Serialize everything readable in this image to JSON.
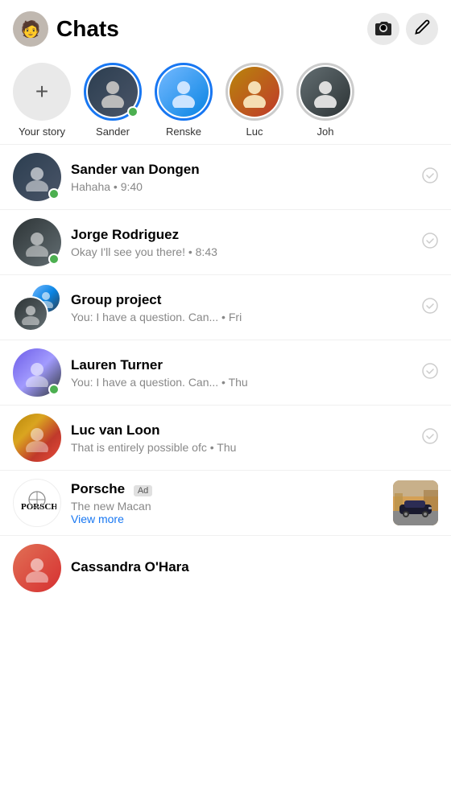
{
  "header": {
    "title": "Chats",
    "camera_icon": "📷",
    "edit_icon": "✏"
  },
  "stories": {
    "add_label": "Your story",
    "items": [
      {
        "id": "sander",
        "label": "Sander",
        "online": true,
        "has_ring": true,
        "color_class": "story-sander"
      },
      {
        "id": "renske",
        "label": "Renske",
        "online": false,
        "has_ring": true,
        "color_class": "story-renske"
      },
      {
        "id": "luc",
        "label": "Luc",
        "online": false,
        "has_ring": false,
        "color_class": "story-luc"
      },
      {
        "id": "joh",
        "label": "Joh",
        "online": false,
        "has_ring": false,
        "color_class": "story-joh"
      }
    ]
  },
  "chats": [
    {
      "id": "sander",
      "name": "Sander van Dongen",
      "preview": "Hahaha • 9:40",
      "online": true,
      "type": "single",
      "color_class": "av-sander"
    },
    {
      "id": "jorge",
      "name": "Jorge Rodriguez",
      "preview": "Okay I'll see you there! • 8:43",
      "online": true,
      "type": "single",
      "color_class": "av-jorge"
    },
    {
      "id": "group",
      "name": "Group project",
      "preview": "You: I have a question. Can... • Fri",
      "online": false,
      "type": "group",
      "color_class": "av-jorge",
      "color_class2": "av-renske"
    },
    {
      "id": "lauren",
      "name": "Lauren Turner",
      "preview": "You: I have a question. Can... • Thu",
      "online": true,
      "type": "single",
      "color_class": "av-lauren"
    },
    {
      "id": "luc",
      "name": "Luc van Loon",
      "preview": "That is entirely possible ofc • Thu",
      "online": false,
      "type": "single",
      "color_class": "av-luc"
    },
    {
      "id": "porsche",
      "name": "Porsche",
      "preview": "The new Macan",
      "view_more": "View more",
      "online": false,
      "type": "ad"
    },
    {
      "id": "cassandra",
      "name": "Cassandra O'Hara",
      "preview": "",
      "online": false,
      "type": "single",
      "color_class": "av-cassandra"
    }
  ]
}
